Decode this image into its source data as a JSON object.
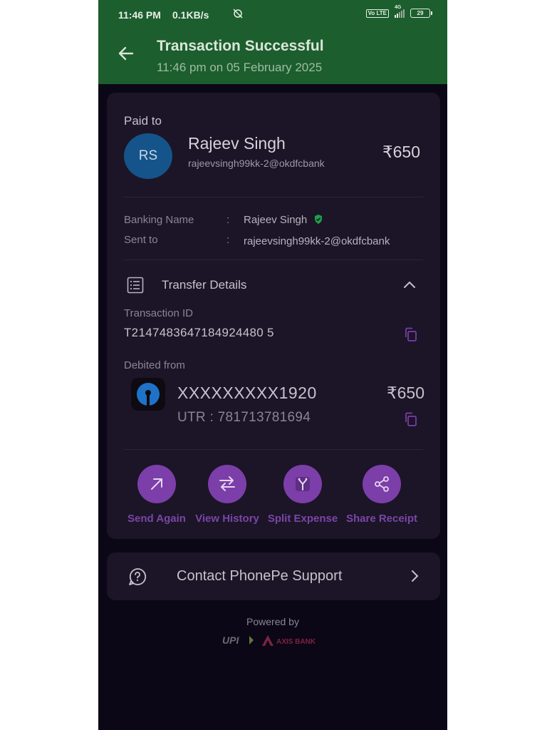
{
  "status_bar": {
    "time": "11:46 PM",
    "data_rate": "0.1KB/s",
    "network": "4G",
    "volte": "Vo LTE",
    "battery": "29"
  },
  "header": {
    "title": "Transaction Successful",
    "subtitle": "11:46 pm on 05 February 2025"
  },
  "payee": {
    "paid_to_label": "Paid to",
    "initials": "RS",
    "name": "Rajeev Singh",
    "upi_id": "rajeevsingh99kk-2@okdfcbank",
    "amount": "₹650"
  },
  "details": {
    "banking_name_label": "Banking Name",
    "banking_name": "Rajeev Singh",
    "sent_to_label": "Sent to",
    "sent_to": "rajeevsingh99kk-2@okdfcbank",
    "colon": ":"
  },
  "transfer": {
    "section_title": "Transfer Details",
    "transaction_id_label": "Transaction ID",
    "transaction_id": "T2147483647184924480 5",
    "debited_from_label": "Debited from",
    "account": "XXXXXXXXX1920",
    "amount": "₹650",
    "utr": "UTR : 781713781694"
  },
  "actions": [
    {
      "label": "Send Again",
      "icon": "arrow-up-right-icon"
    },
    {
      "label": "View History",
      "icon": "swap-arrows-icon"
    },
    {
      "label": "Split Expense",
      "icon": "split-icon"
    },
    {
      "label": "Share Receipt",
      "icon": "share-icon"
    }
  ],
  "support": {
    "label": "Contact PhonePe Support"
  },
  "footer": {
    "powered_by": "Powered by",
    "upi_logo_text": "UPI",
    "bank_logo_text": "AXIS BANK"
  },
  "colors": {
    "header_green": "#1c5e2d",
    "background": "#0c0716",
    "card": "#1b1527",
    "accent_purple": "#7c3ea8",
    "verified_green": "#1f9e4a"
  }
}
